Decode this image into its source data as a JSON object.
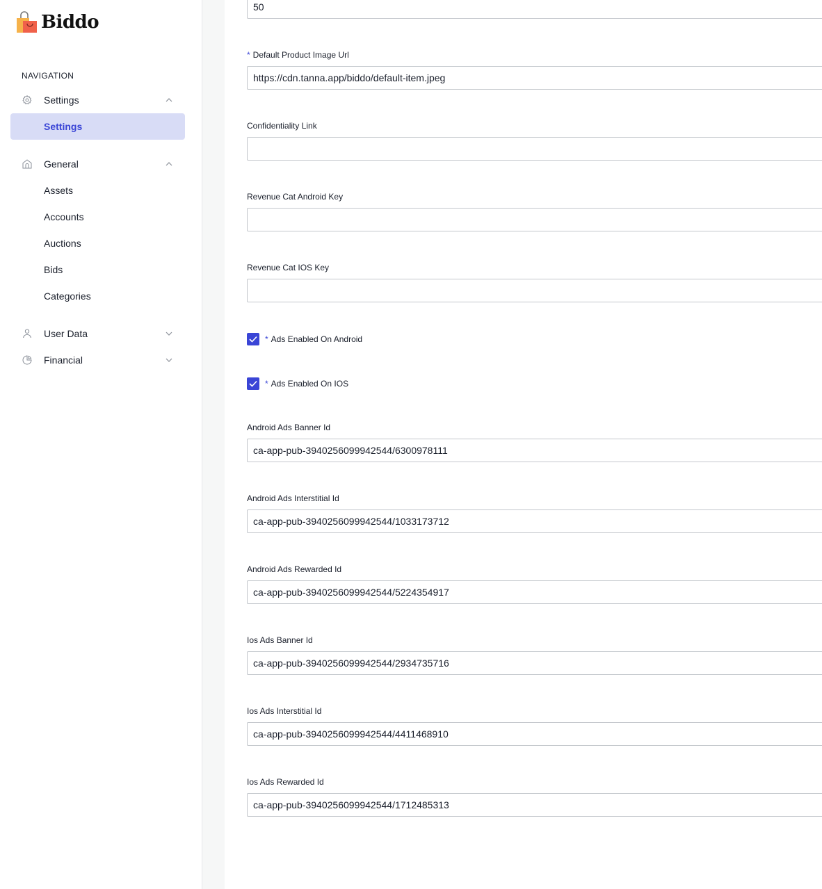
{
  "app": {
    "name": "Biddo"
  },
  "sidebar": {
    "heading": "NAVIGATION",
    "groups": [
      {
        "label": "Settings",
        "icon": "gear-icon",
        "expanded": true,
        "items": [
          {
            "label": "Settings",
            "active": true
          }
        ]
      },
      {
        "label": "General",
        "icon": "home-icon",
        "expanded": true,
        "items": [
          {
            "label": "Assets"
          },
          {
            "label": "Accounts"
          },
          {
            "label": "Auctions"
          },
          {
            "label": "Bids"
          },
          {
            "label": "Categories"
          }
        ]
      },
      {
        "label": "User Data",
        "icon": "user-icon",
        "expanded": false,
        "items": []
      },
      {
        "label": "Financial",
        "icon": "pie-chart-icon",
        "expanded": false,
        "items": []
      }
    ]
  },
  "form": {
    "top_value": "50",
    "fields": {
      "default_product_image_url": {
        "label": "Default Product Image Url",
        "required": true,
        "value": "https://cdn.tanna.app/biddo/default-item.jpeg"
      },
      "confidentiality_link": {
        "label": "Confidentiality Link",
        "required": false,
        "value": ""
      },
      "revenue_cat_android_key": {
        "label": "Revenue Cat Android Key",
        "required": false,
        "value": ""
      },
      "revenue_cat_ios_key": {
        "label": "Revenue Cat IOS Key",
        "required": false,
        "value": ""
      },
      "ads_enabled_android": {
        "label": "Ads Enabled On Android",
        "required": true,
        "checked": true
      },
      "ads_enabled_ios": {
        "label": "Ads Enabled On IOS",
        "required": true,
        "checked": true
      },
      "android_ads_banner_id": {
        "label": "Android Ads Banner Id",
        "value": "ca-app-pub-3940256099942544/6300978111"
      },
      "android_ads_interstitial_id": {
        "label": "Android Ads Interstitial Id",
        "value": "ca-app-pub-3940256099942544/1033173712"
      },
      "android_ads_rewarded_id": {
        "label": "Android Ads Rewarded Id",
        "value": "ca-app-pub-3940256099942544/5224354917"
      },
      "ios_ads_banner_id": {
        "label": "Ios Ads Banner Id",
        "value": "ca-app-pub-3940256099942544/2934735716"
      },
      "ios_ads_interstitial_id": {
        "label": "Ios Ads Interstitial Id",
        "value": "ca-app-pub-3940256099942544/4411468910"
      },
      "ios_ads_rewarded_id": {
        "label": "Ios Ads Rewarded Id",
        "value": "ca-app-pub-3940256099942544/1712485313"
      }
    },
    "required_marker": "*"
  },
  "colors": {
    "accent": "#3a45d6",
    "active_bg": "#d8dcf6",
    "input_border": "#c3c7cc",
    "gutter": "#f6f7f7"
  }
}
